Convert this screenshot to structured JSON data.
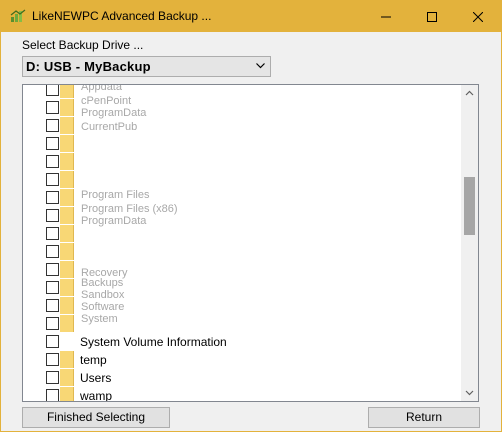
{
  "window": {
    "title": "LikeNEWPC Advanced Backup ...",
    "accent_color": "#e3b23c",
    "controls": [
      "minimize-icon",
      "maximize-icon",
      "close-icon"
    ]
  },
  "drive": {
    "label": "Select Backup Drive ...",
    "selected": "D: USB - MyBackup"
  },
  "folders": {
    "visible_items": [
      "System Volume Information",
      "temp",
      "Users",
      "wamp"
    ],
    "ghost_text": [
      "Appdata",
      "cPenPoint",
      "ProgramData",
      "CurrentPub",
      "Program Files",
      "Program Files (x86)",
      "ProgramData",
      "Recovery",
      "Backups",
      "Sandbox",
      "Software",
      "System"
    ]
  },
  "buttons": {
    "finished": "Finished Selecting",
    "return": "Return"
  }
}
